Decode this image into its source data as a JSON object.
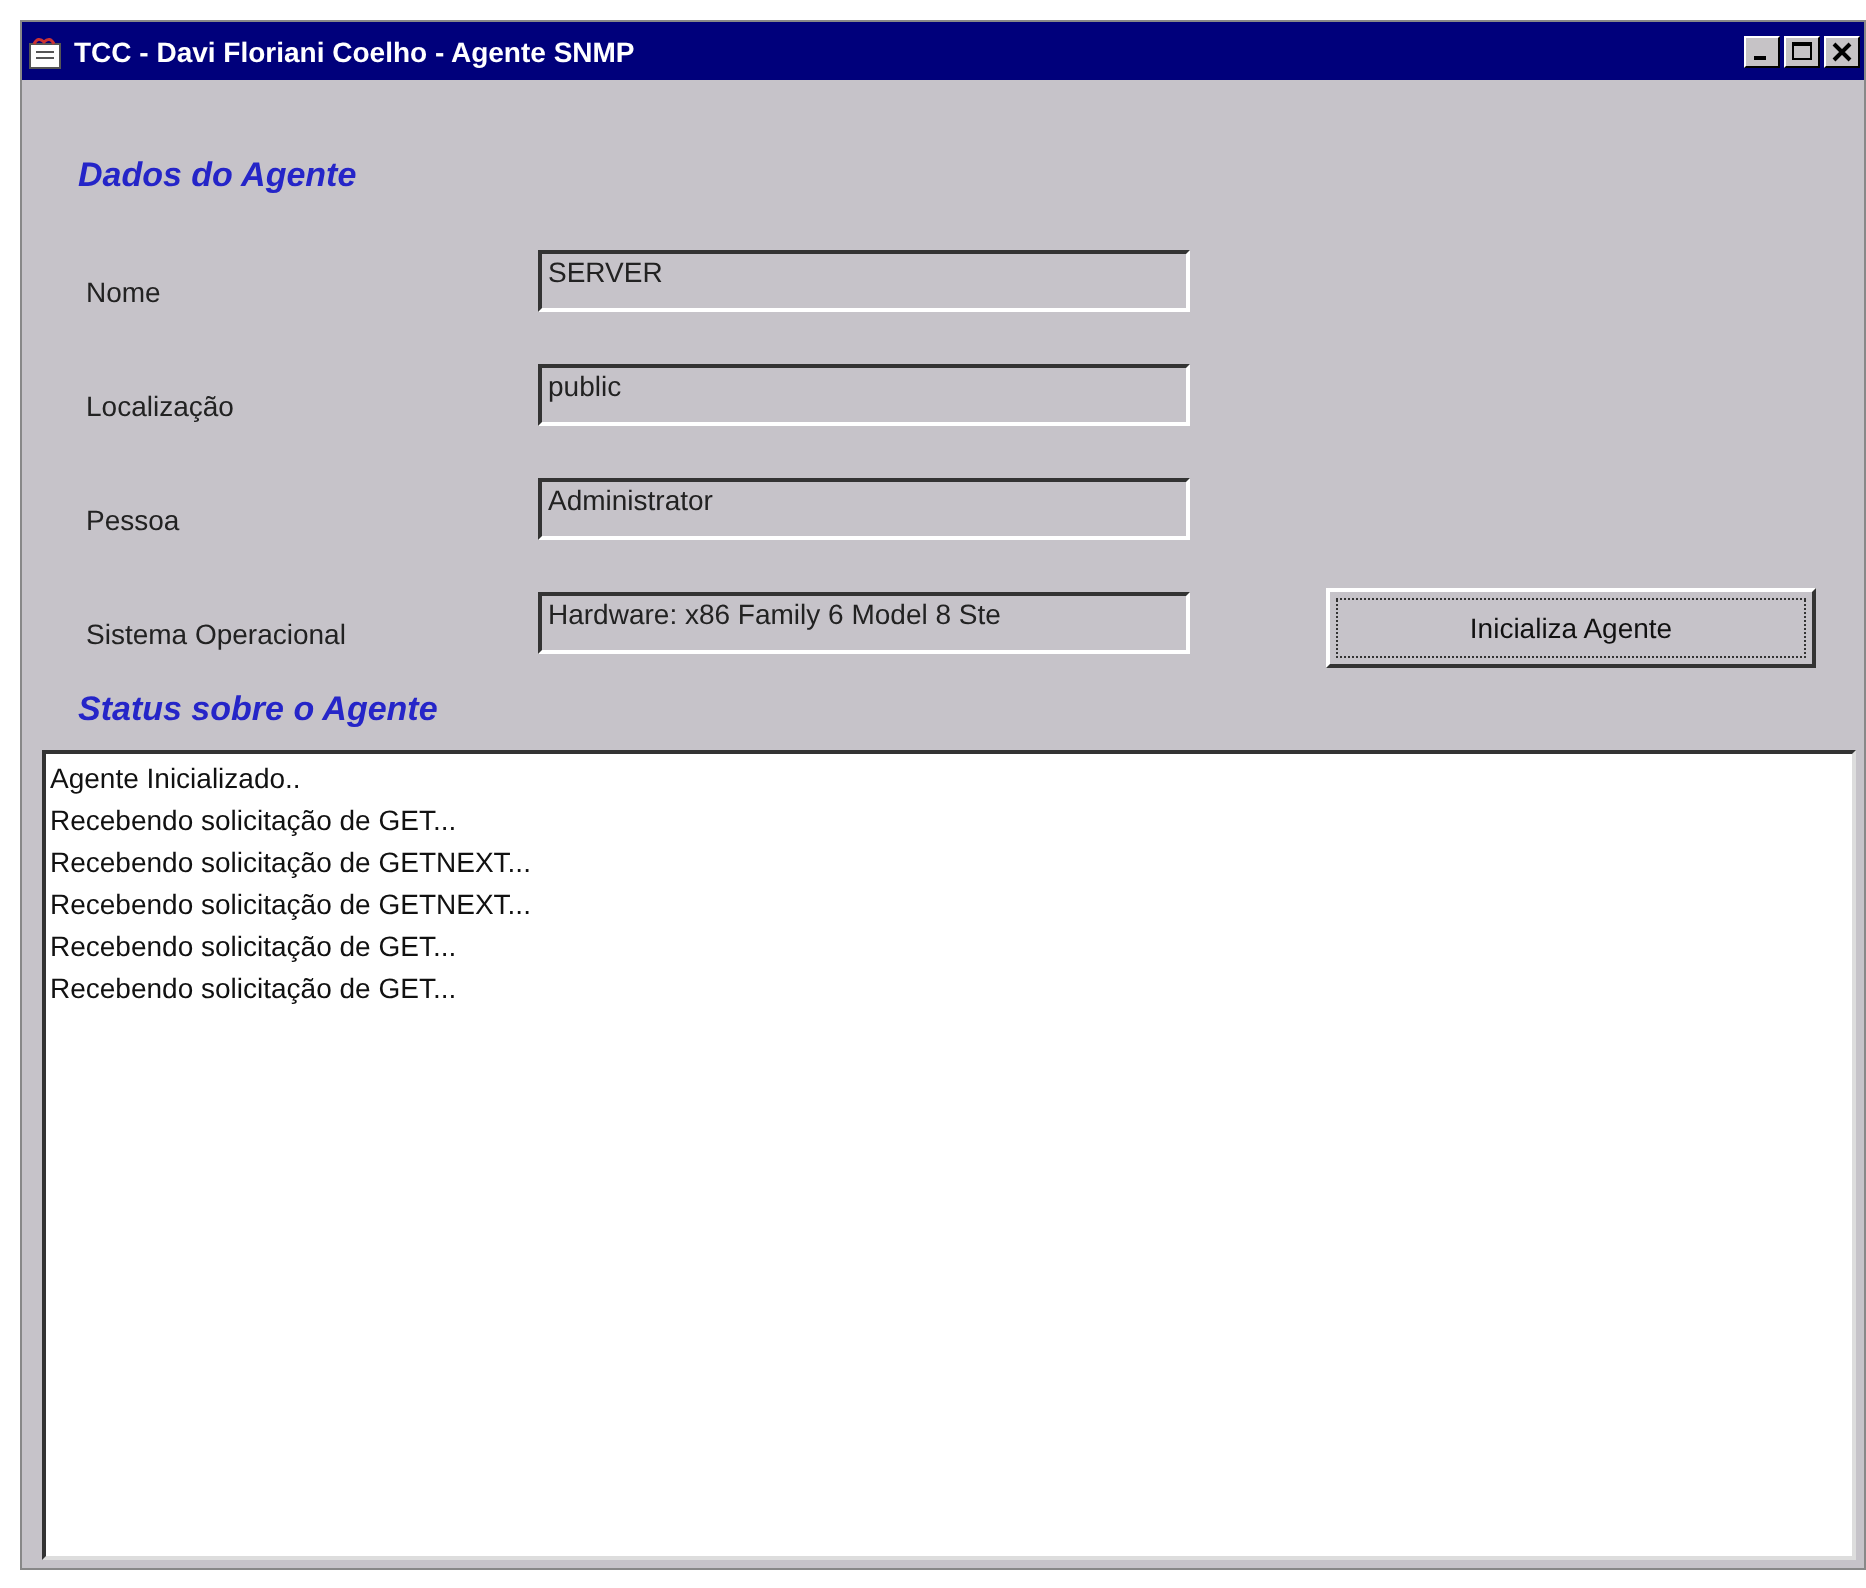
{
  "window": {
    "title": "TCC - Davi Floriani Coelho - Agente SNMP"
  },
  "agent_section": {
    "title": "Dados do Agente"
  },
  "fields": [
    {
      "label": "Nome",
      "value": "SERVER"
    },
    {
      "label": "Localização",
      "value": "public"
    },
    {
      "label": "Pessoa",
      "value": "Administrator"
    },
    {
      "label": "Sistema Operacional",
      "value": "Hardware: x86 Family 6 Model 8 Ste"
    }
  ],
  "start_button": {
    "label": "Inicializa Agente"
  },
  "status_section": {
    "title": "Status sobre o Agente"
  },
  "log": [
    "Agente Inicializado..",
    "Recebendo solicitação de GET...",
    "Recebendo solicitação de GETNEXT...",
    "Recebendo solicitação de GETNEXT...",
    "Recebendo solicitação de GET...",
    "Recebendo solicitação de GET..."
  ]
}
